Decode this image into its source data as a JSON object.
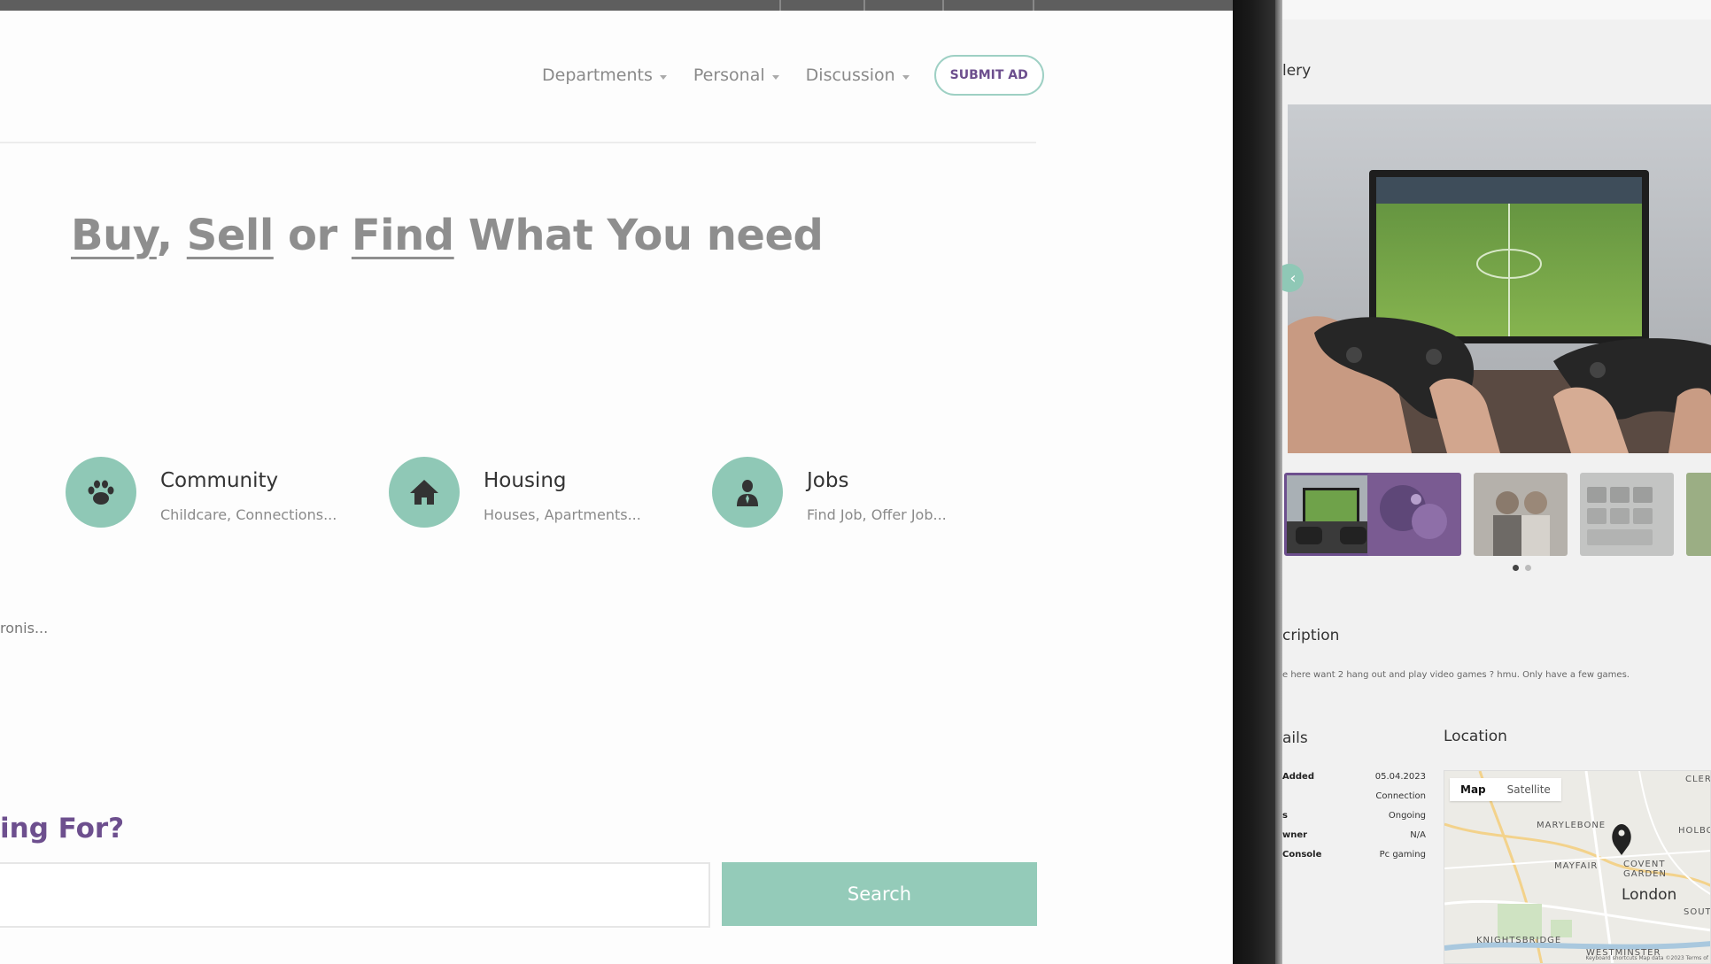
{
  "nav": {
    "items": [
      {
        "label": "Departments"
      },
      {
        "label": "Personal"
      },
      {
        "label": "Discussion"
      }
    ],
    "submit_label": "SUBMIT AD"
  },
  "hero": {
    "word1": "Buy",
    "sep1": ", ",
    "word2": "Sell",
    "sep2": " or ",
    "word3": "Find",
    "rest": " What You need"
  },
  "categories": [
    {
      "title": "Community",
      "sub": "Childcare,  Connections...",
      "icon": "paw-icon"
    },
    {
      "title": "Housing",
      "sub": "Houses,  Apartments...",
      "icon": "house-icon"
    },
    {
      "title": "Jobs",
      "sub": "Find Job,  Offer Job...",
      "icon": "person-icon"
    }
  ],
  "partial_category_text": "ronis...",
  "search": {
    "heading": "ing For?",
    "placeholder": "",
    "button_label": "Search"
  },
  "detail_page": {
    "gallery_heading": "lery",
    "description_heading": "cription",
    "description_text": "e here want 2 hang out and play video games ? hmu. Only have a few games.",
    "details_heading": "ails",
    "details": [
      {
        "key": "Added",
        "value": "05.04.2023"
      },
      {
        "key": "",
        "value": "Connection"
      },
      {
        "key": "s",
        "value": "Ongoing"
      },
      {
        "key": "wner",
        "value": "N/A"
      },
      {
        "key": "Console",
        "value": "Pc gaming"
      }
    ],
    "location_heading": "Location",
    "map": {
      "tabs": [
        "Map",
        "Satellite"
      ],
      "active_tab": "Map",
      "labels": [
        "MARYLEBONE",
        "MAYFAIR",
        "COVENT GARDEN",
        "KNIGHTSBRIDGE",
        "WESTMINSTER",
        "HOLBO",
        "CLER",
        "SOUTH"
      ],
      "city": "London",
      "footer": "Keyboard shortcuts   Map data ©2023   Terms of"
    }
  },
  "colors": {
    "accent_teal": "#8fc8b6",
    "accent_purple": "#6d4f8e"
  }
}
